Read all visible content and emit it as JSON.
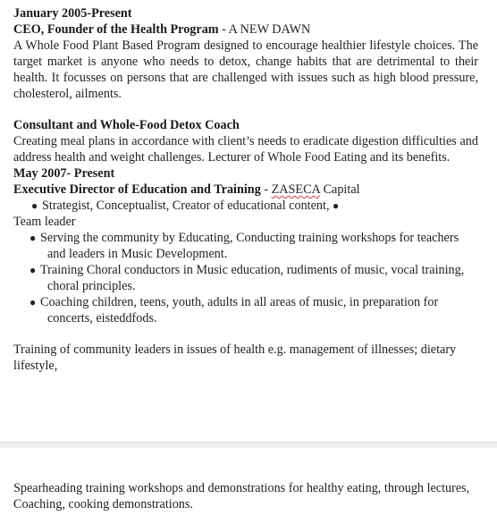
{
  "section1": {
    "date": "January 2005-Present",
    "title": "CEO, Founder of the Health Program",
    "title_sep": " - ",
    "org": "A NEW DAWN",
    "desc": "A Whole Food Plant Based Program designed to encourage healthier lifestyle choices. The target market is anyone who needs to detox, change habits that are detrimental to their health. It focusses on persons that are challenged with issues such as high blood pressure, cholesterol, ailments."
  },
  "section2": {
    "title": "Consultant and Whole-Food Detox Coach",
    "desc": "Creating meal plans in accordance with client’s needs to eradicate digestion difficulties and address health and weight challenges. Lecturer of Whole Food Eating and its benefits."
  },
  "section3": {
    "date_bold": "May 2007",
    "date_rest": "- Present",
    "title": "Executive Director of Education and Training",
    "title_sep": " - ",
    "org_flagged": "ZASECA",
    "org_rest": " Capital",
    "bullet_glyph": "●",
    "bullet1": "Strategist, Conceptualist, Creator of educational content,",
    "bullet1_tail": "Team leader",
    "bullets": [
      "Serving the community by Educating, Conducting training workshops for teachers and leaders in Music Development.",
      "Training Choral conductors in Music education, rudiments of music, vocal training, choral principles.",
      "Coaching children, teens, youth, adults in all areas of music, in preparation for concerts, eisteddfods."
    ],
    "footer": "Training of community leaders in issues of health e.g. management of illnesses; dietary lifestyle,"
  },
  "page2": {
    "text": "Spearheading training workshops and demonstrations for healthy eating, through lectures, Coaching, cooking demonstrations."
  },
  "colors": {
    "text": "#222222",
    "spellcheck": "#d23b3b",
    "page_gap": "#f1f1f1"
  }
}
